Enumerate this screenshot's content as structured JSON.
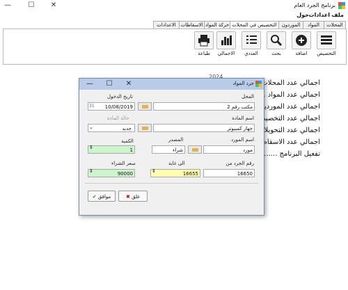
{
  "window": {
    "title": "برنامج الجرد العام"
  },
  "menu": [
    "ملف",
    "اعدادات",
    "حول"
  ],
  "tabs": [
    "المحلات",
    "المواد",
    "الموردون",
    "التخصيص في المحلات",
    "حركة المواد",
    "الاسقاطات",
    "الاعدادات"
  ],
  "ribbon": [
    "التخصيص",
    "اضافة",
    "بحث",
    "العددي",
    "الاجمالي",
    "طباعة"
  ],
  "stats": [
    "اجمالي عدد المحلات .......",
    "اجمالي عدد المواد .......",
    "اجمالي عدد الموردين .......",
    "اجمالي عدد التخصيصات .......",
    "اجمالي عدد التحويلات .......",
    "اجمالي عدد الاسقاطات .......",
    "تفعيل البرنامج ......."
  ],
  "stats_header": "2024",
  "dialog": {
    "title": "جرد المواد",
    "store_label": "المحل",
    "store_value": "مكتب رقم 2",
    "date_label": "تاريخ الدخول",
    "date_value": "10/08/2019",
    "item_label": "اسم المادة",
    "item_value": "جهاز كمبيوتر",
    "condition_label": "حالة المادة",
    "condition_value": "جديد",
    "supplier_label": "اسم المورد",
    "supplier_value": "مورد",
    "source_label": "المصدر",
    "source_value": "شراء",
    "qty_label": "الكمية",
    "qty_value": "1",
    "from_label": "رقم الجرد من",
    "from_value": "16650",
    "to_label": "الى غاية",
    "to_value": "16655",
    "price_label": "سعر الشراء",
    "price_value": "90000",
    "ok_label": "موافق",
    "close_label": "غلق"
  },
  "colors": {
    "accent": "#b8cbe8",
    "yellow": "#ffffb3",
    "green": "#ccf5cc"
  }
}
